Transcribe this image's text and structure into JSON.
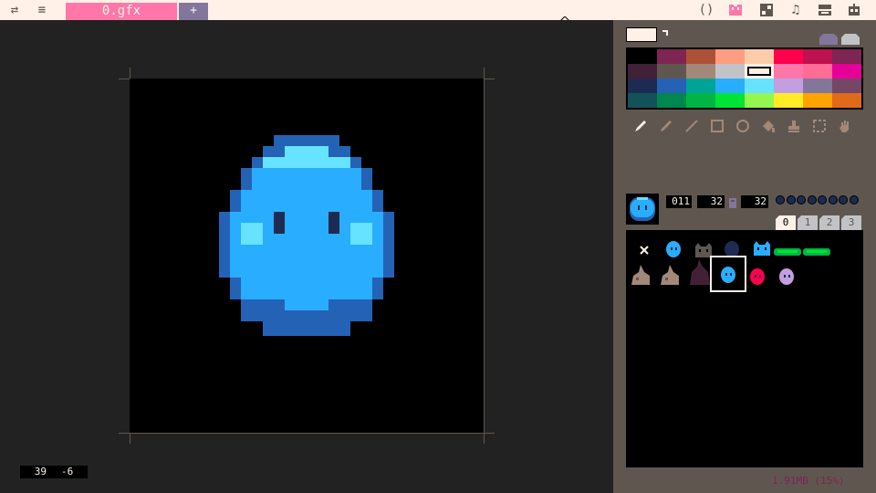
{
  "topbar": {
    "menu_icons": [
      "swap-icon",
      "hamburger-icon"
    ],
    "file_tab": "0.gfx",
    "add_tab": "+",
    "right_icons": [
      "code-icon",
      "sprite-icon",
      "map-icon",
      "music-icon",
      "sfx-icon",
      "robot-icon"
    ]
  },
  "canvas": {
    "background": "#000000",
    "coords": {
      "x": "39",
      "y": "-6"
    }
  },
  "color_selector": {
    "current_color": "#fff1e8",
    "palette": [
      "#000000",
      "#7e2553",
      "#ab5236",
      "#ff9d81",
      "#ffccaa",
      "#ff004d",
      "#be1250",
      "#7e2553",
      "#422136",
      "#5f574f",
      "#a28879",
      "#c2c3c7",
      "#fff1e8",
      "#ff77a8",
      "#ff6c96",
      "#e60099",
      "#1d2b53",
      "#2462b6",
      "#00a497",
      "#29adff",
      "#65e3ff",
      "#c29fe0",
      "#83769c",
      "#754665",
      "#125359",
      "#008751",
      "#00b543",
      "#00e436",
      "#94f64f",
      "#ffec27",
      "#ffa300",
      "#e06a1c"
    ],
    "selected_index": 12
  },
  "tools": [
    "pencil-icon",
    "brush-icon",
    "line-icon",
    "rectangle-icon",
    "circle-icon",
    "fill-icon",
    "stamp-icon",
    "select-icon",
    "hand-icon"
  ],
  "sprite": {
    "index": "011",
    "width": "32",
    "height": "32",
    "flags": [
      0,
      0,
      0,
      0,
      0,
      0,
      0,
      0
    ]
  },
  "banks": [
    "0",
    "1",
    "2",
    "3"
  ],
  "active_bank": 0,
  "sheet_items": [
    {
      "name": "x-mark",
      "color": "#fff1e8"
    },
    {
      "name": "blue-slime-small",
      "color": "#29adff"
    },
    {
      "name": "brown-cat",
      "color": "#5f574f"
    },
    {
      "name": "dark-slime",
      "color": "#1d2b53"
    },
    {
      "name": "blue-cat",
      "color": "#29adff"
    },
    {
      "name": "green-platform-1",
      "color": "#00b543"
    },
    {
      "name": "green-platform-2",
      "color": "#00b543"
    },
    {
      "name": "rabbit-1",
      "color": "#a28879"
    },
    {
      "name": "rabbit-2",
      "color": "#a28879"
    },
    {
      "name": "dark-figure",
      "color": "#422136"
    },
    {
      "name": "blue-slime-selected",
      "color": "#29adff"
    },
    {
      "name": "red-slime",
      "color": "#ff004d"
    },
    {
      "name": "purple-slime",
      "color": "#c29fe0"
    }
  ],
  "selected_sheet_item": 10,
  "memory": "1.91MB (15%)"
}
